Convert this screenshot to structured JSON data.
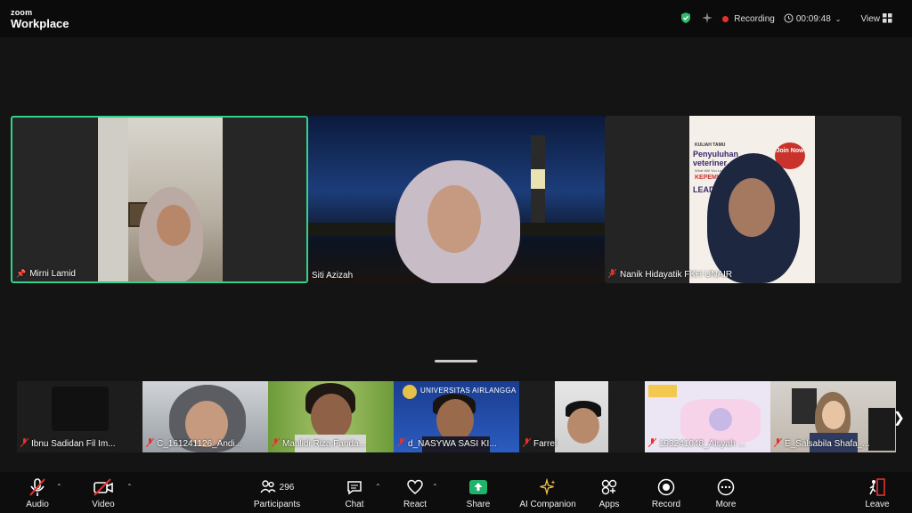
{
  "app": {
    "brand_top": "zoom",
    "brand_bottom": "Workplace"
  },
  "header": {
    "recording_label": "Recording",
    "timer": "00:09:48",
    "view_label": "View"
  },
  "speakers": [
    {
      "name": "Mirni Lamid"
    },
    {
      "name": "Siti Azizah"
    },
    {
      "name": "Nanik Hidayatik FKH UNAIR"
    }
  ],
  "poster": {
    "line1": "KULIAH TAMU",
    "line2": "Penyuluhan",
    "line3": "veteriner",
    "line4": "What Will You Learn?",
    "line5": "KEPEMIN",
    "line6": "LEADE",
    "badge": "Join Now"
  },
  "gallery": [
    {
      "name": "Ibnu Sadidan Fil Im..."
    },
    {
      "name": "C_161241126_Andi..."
    },
    {
      "name": "Maulidi Riza Farida..."
    },
    {
      "name": "d_NASYWA SASI KI..."
    },
    {
      "name": "Farrel"
    },
    {
      "name": "193241048_Aisyah ..."
    },
    {
      "name": "E_Salsabila Shafa_..."
    }
  ],
  "gallery_banner": "UNIVERSITAS AIRLANGGA",
  "toolbar": {
    "audio": "Audio",
    "video": "Video",
    "participants": "Participants",
    "participants_count": "296",
    "chat": "Chat",
    "react": "React",
    "share": "Share",
    "ai": "AI Companion",
    "apps": "Apps",
    "record": "Record",
    "more": "More",
    "leave": "Leave"
  },
  "colors": {
    "accent_green": "#33d18a",
    "record_red": "#e5322d",
    "share_green": "#1fb36b"
  }
}
